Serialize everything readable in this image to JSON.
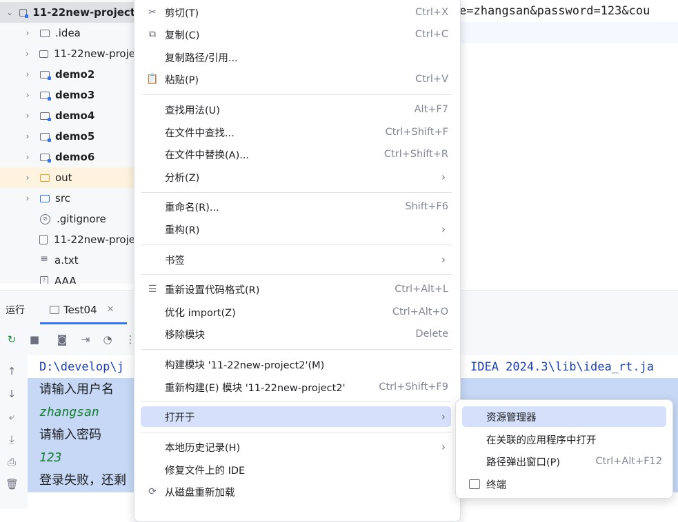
{
  "project_tree": {
    "root": {
      "label": "11-22new-project",
      "expanded": true
    },
    "items": [
      {
        "label": ".idea",
        "icon": "folder-icon",
        "bold": false
      },
      {
        "label": "11-22new-proje",
        "icon": "folder-icon",
        "bold": false
      },
      {
        "label": "demo2",
        "icon": "module-folder-icon",
        "bold": true
      },
      {
        "label": "demo3",
        "icon": "module-folder-icon",
        "bold": true
      },
      {
        "label": "demo4",
        "icon": "module-folder-icon",
        "bold": true
      },
      {
        "label": "demo5",
        "icon": "module-folder-icon",
        "bold": true
      },
      {
        "label": "demo6",
        "icon": "module-folder-icon",
        "bold": true
      },
      {
        "label": "out",
        "icon": "excluded-folder-icon",
        "bold": false
      },
      {
        "label": "src",
        "icon": "source-folder-icon",
        "bold": false
      },
      {
        "label": ".gitignore",
        "icon": "ignore-file-icon",
        "bold": false
      },
      {
        "label": "11-22new-proje",
        "icon": "iml-file-icon",
        "bold": false
      },
      {
        "label": "a.txt",
        "icon": "text-file-icon",
        "bold": false
      },
      {
        "label": "AAA",
        "icon": "unknown-file-icon",
        "bold": false
      }
    ]
  },
  "editor": {
    "visible_text": "e=zhangsan&password=123&cou"
  },
  "run_panel": {
    "title": "运行",
    "tab_label": "Test04",
    "console_lines": [
      {
        "text": "D:\\develop\\j",
        "tail": "IDEA 2024.3\\lib\\idea_rt.ja",
        "kind": "command"
      },
      {
        "text": "请输入用户名",
        "kind": "output"
      },
      {
        "text": "zhangsan",
        "kind": "input"
      },
      {
        "text": "请输入密码",
        "kind": "output"
      },
      {
        "text": "123",
        "kind": "input"
      },
      {
        "text": "登录失败，还剩",
        "kind": "output"
      }
    ]
  },
  "context_menu": {
    "items": [
      {
        "label": "剪切(T)",
        "shortcut": "Ctrl+X",
        "icon": "scissors-icon"
      },
      {
        "label": "复制(C)",
        "shortcut": "Ctrl+C",
        "icon": "copy-icon"
      },
      {
        "label": "复制路径/引用...",
        "shortcut": "",
        "icon": ""
      },
      {
        "label": "粘贴(P)",
        "shortcut": "Ctrl+V",
        "icon": "paste-icon"
      },
      {
        "label": "查找用法(U)",
        "shortcut": "Alt+F7",
        "icon": ""
      },
      {
        "label": "在文件中查找...",
        "shortcut": "Ctrl+Shift+F",
        "icon": ""
      },
      {
        "label": "在文件中替换(A)...",
        "shortcut": "Ctrl+Shift+R",
        "icon": ""
      },
      {
        "label": "分析(Z)",
        "shortcut": "",
        "icon": "",
        "submenu": true
      },
      {
        "label": "重命名(R)...",
        "shortcut": "Shift+F6",
        "icon": ""
      },
      {
        "label": "重构(R)",
        "shortcut": "",
        "icon": "",
        "submenu": true
      },
      {
        "label": "书签",
        "shortcut": "",
        "icon": "",
        "submenu": true
      },
      {
        "label": "重新设置代码格式(R)",
        "shortcut": "Ctrl+Alt+L",
        "icon": "reformat-icon"
      },
      {
        "label": "优化 import(Z)",
        "shortcut": "Ctrl+Alt+O",
        "icon": ""
      },
      {
        "label": "移除模块",
        "shortcut": "Delete",
        "icon": ""
      },
      {
        "label": "构建模块 '11-22new-project2'(M)",
        "shortcut": "",
        "icon": ""
      },
      {
        "label": "重新构建(E) 模块 '11-22new-project2'",
        "shortcut": "Ctrl+Shift+F9",
        "icon": ""
      },
      {
        "label": "打开于",
        "shortcut": "",
        "icon": "",
        "submenu": true,
        "active": true
      },
      {
        "label": "本地历史记录(H)",
        "shortcut": "",
        "icon": "",
        "submenu": true
      },
      {
        "label": "修复文件上的 IDE",
        "shortcut": "",
        "icon": ""
      },
      {
        "label": "从磁盘重新加载",
        "shortcut": "",
        "icon": "reload-icon"
      }
    ]
  },
  "submenu_open_in": {
    "items": [
      {
        "label": "资源管理器",
        "shortcut": "",
        "active": true
      },
      {
        "label": "在关联的应用程序中打开",
        "shortcut": ""
      },
      {
        "label": "路径弹出窗口(P)",
        "shortcut": "Ctrl+Alt+F12"
      },
      {
        "label": "终端",
        "shortcut": "",
        "icon": "terminal-icon"
      }
    ]
  },
  "colors": {
    "accent": "#3574f0",
    "selection": "#d5e1fb",
    "console_selection": "#c6d8f5",
    "input_text": "#0f7d2e",
    "command_text": "#1a3fb5"
  }
}
